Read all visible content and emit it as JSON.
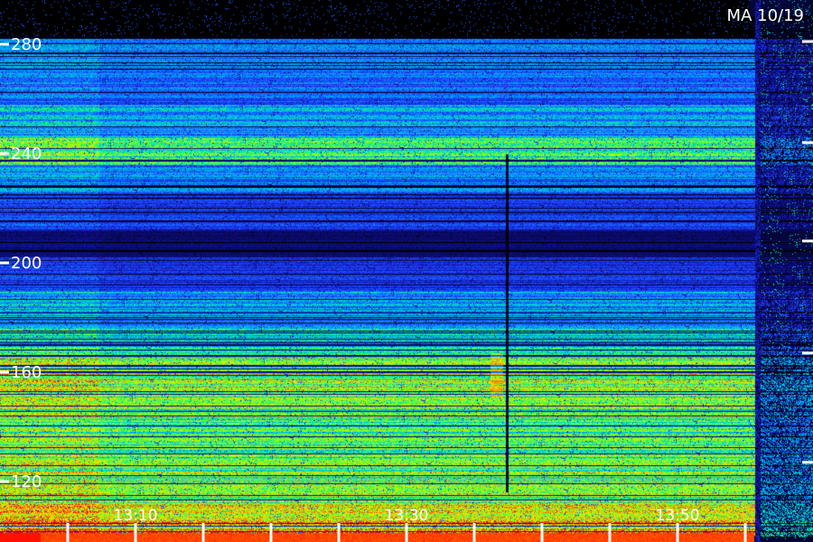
{
  "chart_data": {
    "type": "heatmap",
    "title": "",
    "corner_label": "MA 10/19",
    "xlabel": "",
    "ylabel": "",
    "y_ticks": [
      280,
      240,
      200,
      160,
      120
    ],
    "ylim": [
      100,
      290
    ],
    "x_ticks": [
      "13:10",
      "13:30",
      "13:50"
    ],
    "x_tick_times": [
      13.1667,
      13.5,
      13.8333
    ],
    "xlim": [
      13.0,
      14.0
    ],
    "colormap": [
      "#000000",
      "#1010a0",
      "#2040ff",
      "#00a0ff",
      "#00e0c0",
      "#40ff40",
      "#c0ff00",
      "#ffd000",
      "#ff6000",
      "#ff0000"
    ],
    "background_color": "#000000",
    "text_color": "#ffffff",
    "intensity_bands": [
      {
        "y_from": 290,
        "y_to": 282,
        "level": 0.02
      },
      {
        "y_from": 282,
        "y_to": 270,
        "level": 0.3
      },
      {
        "y_from": 270,
        "y_to": 258,
        "level": 0.28
      },
      {
        "y_from": 258,
        "y_to": 246,
        "level": 0.36
      },
      {
        "y_from": 246,
        "y_to": 236,
        "level": 0.52
      },
      {
        "y_from": 236,
        "y_to": 226,
        "level": 0.32
      },
      {
        "y_from": 226,
        "y_to": 212,
        "level": 0.22
      },
      {
        "y_from": 212,
        "y_to": 202,
        "level": 0.08
      },
      {
        "y_from": 202,
        "y_to": 190,
        "level": 0.2
      },
      {
        "y_from": 190,
        "y_to": 176,
        "level": 0.35
      },
      {
        "y_from": 176,
        "y_to": 166,
        "level": 0.45
      },
      {
        "y_from": 166,
        "y_to": 152,
        "level": 0.66
      },
      {
        "y_from": 152,
        "y_to": 140,
        "level": 0.58
      },
      {
        "y_from": 140,
        "y_to": 128,
        "level": 0.55
      },
      {
        "y_from": 128,
        "y_to": 116,
        "level": 0.62
      },
      {
        "y_from": 116,
        "y_to": 106,
        "level": 0.68
      },
      {
        "y_from": 106,
        "y_to": 100,
        "level": 0.82
      }
    ]
  }
}
